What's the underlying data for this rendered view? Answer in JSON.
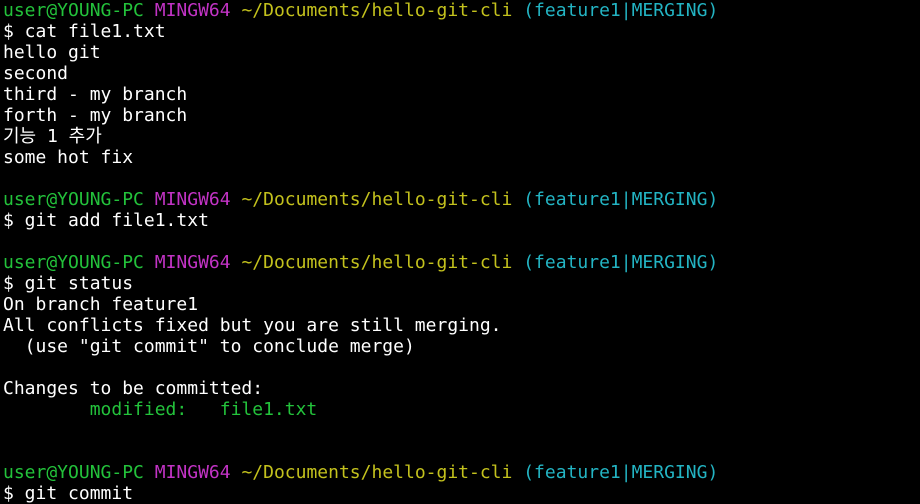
{
  "window": {
    "background": "#000000",
    "colors": {
      "user_host": "#23c23b",
      "msystem": "#c233c5",
      "path": "#c3c11d",
      "branch": "#23b4c3",
      "output": "#ffffff",
      "staged": "#23c23b"
    }
  },
  "lines": [
    {
      "type": "prompt",
      "user_host": "user@YOUNG-PC",
      "msystem": "MINGW64",
      "path": "~/Documents/hello-git-cli",
      "branch": "(feature1|MERGING)"
    },
    {
      "type": "output",
      "text": "$ cat file1.txt"
    },
    {
      "type": "output",
      "text": "hello git"
    },
    {
      "type": "output",
      "text": "second"
    },
    {
      "type": "output",
      "text": "third - my branch"
    },
    {
      "type": "output",
      "text": "forth - my branch"
    },
    {
      "type": "output",
      "text": "기능 1 추가"
    },
    {
      "type": "output",
      "text": "some hot fix"
    },
    {
      "type": "blank",
      "text": ""
    },
    {
      "type": "prompt",
      "user_host": "user@YOUNG-PC",
      "msystem": "MINGW64",
      "path": "~/Documents/hello-git-cli",
      "branch": "(feature1|MERGING)"
    },
    {
      "type": "output",
      "text": "$ git add file1.txt"
    },
    {
      "type": "blank",
      "text": ""
    },
    {
      "type": "prompt",
      "user_host": "user@YOUNG-PC",
      "msystem": "MINGW64",
      "path": "~/Documents/hello-git-cli",
      "branch": "(feature1|MERGING)"
    },
    {
      "type": "output",
      "text": "$ git status"
    },
    {
      "type": "output",
      "text": "On branch feature1"
    },
    {
      "type": "output",
      "text": "All conflicts fixed but you are still merging."
    },
    {
      "type": "output",
      "text": "  (use \"git commit\" to conclude merge)"
    },
    {
      "type": "blank",
      "text": ""
    },
    {
      "type": "output",
      "text": "Changes to be committed:"
    },
    {
      "type": "staged",
      "text": "        modified:   file1.txt"
    },
    {
      "type": "blank",
      "text": ""
    },
    {
      "type": "blank",
      "text": ""
    },
    {
      "type": "prompt",
      "user_host": "user@YOUNG-PC",
      "msystem": "MINGW64",
      "path": "~/Documents/hello-git-cli",
      "branch": "(feature1|MERGING)"
    },
    {
      "type": "output",
      "text": "$ git commit"
    }
  ]
}
